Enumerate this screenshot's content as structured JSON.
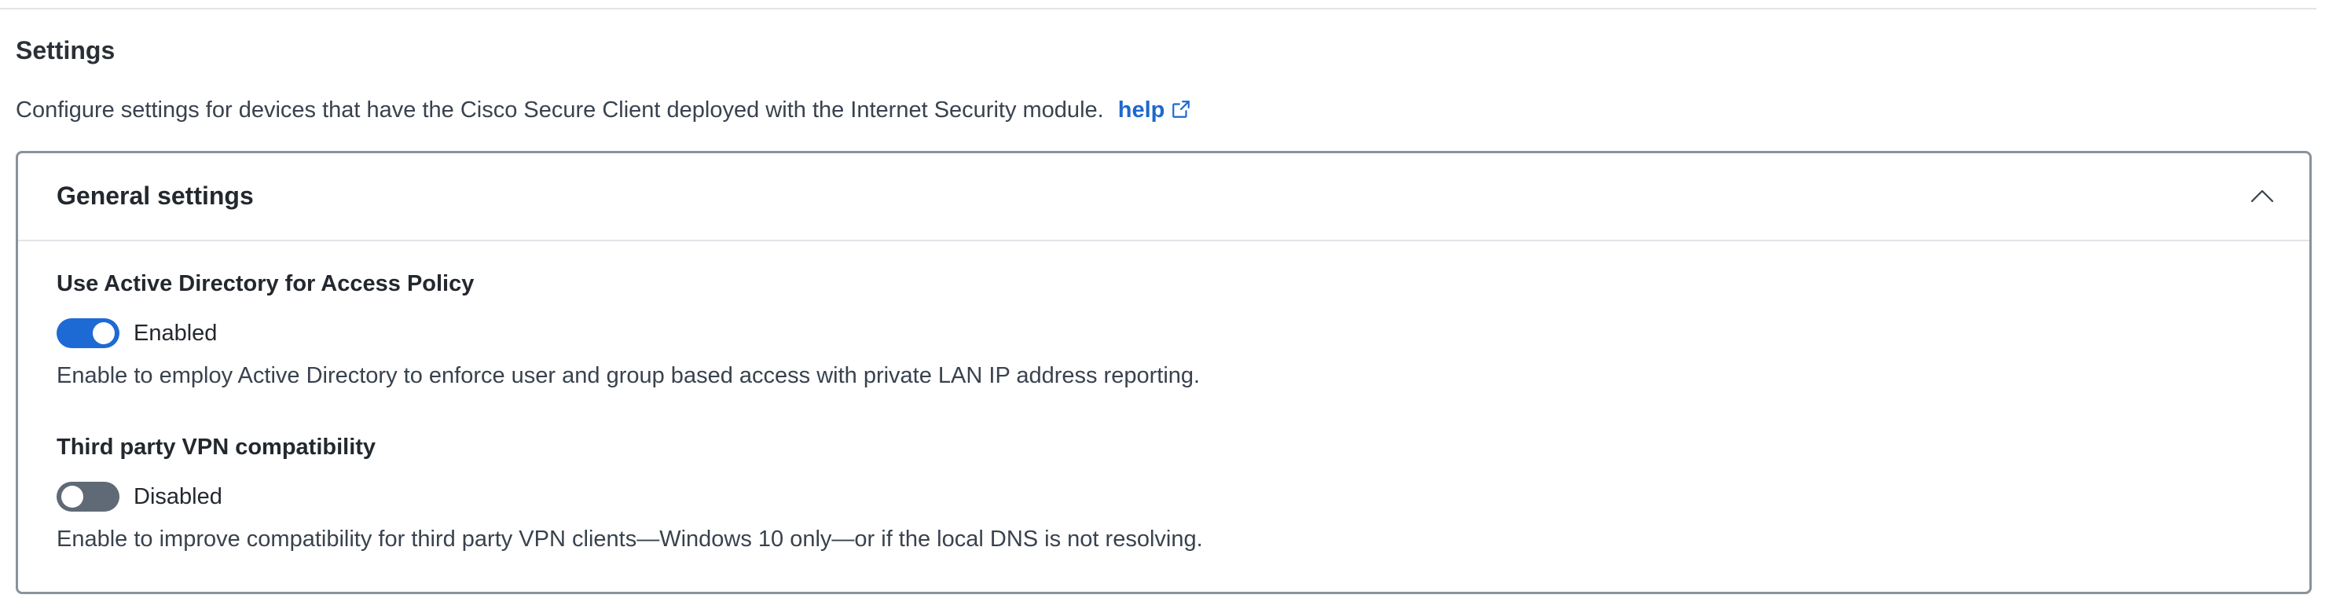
{
  "section": {
    "title": "Settings",
    "description": "Configure settings for devices that have the Cisco Secure Client deployed with the Internet Security module.",
    "help_label": "help",
    "help_icon": "external-link-icon"
  },
  "card": {
    "title": "General settings",
    "collapse_icon": "chevron-up-icon",
    "settings": [
      {
        "label": "Use Active Directory for Access Policy",
        "state": "Enabled",
        "enabled": true,
        "description": "Enable to employ Active Directory to enforce user and group based access with private LAN IP address reporting."
      },
      {
        "label": "Third party VPN compatibility",
        "state": "Disabled",
        "enabled": false,
        "description": "Enable to improve compatibility for third party VPN clients—Windows 10 only—or if the local DNS is not resolving."
      }
    ]
  },
  "colors": {
    "link": "#1d69cc",
    "toggle_on": "#1d6ad5",
    "toggle_off": "#5f6a76",
    "card_border": "#8a929c"
  }
}
